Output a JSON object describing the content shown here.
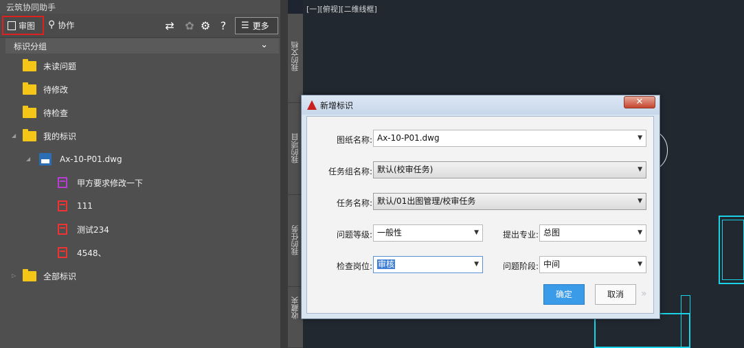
{
  "panel": {
    "title": "云筑协同助手",
    "toolbar": {
      "review_label": "审图",
      "collab_label": "协作",
      "more_label": "更多"
    },
    "group_header": "标识分组",
    "tree": [
      {
        "label": "未读问题"
      },
      {
        "label": "待修改"
      },
      {
        "label": "待检查"
      },
      {
        "label": "我的标识"
      },
      {
        "label": "Ax-10-P01.dwg"
      },
      {
        "label": "甲方要求修改一下"
      },
      {
        "label": "111"
      },
      {
        "label": "测试234"
      },
      {
        "label": "4548、"
      },
      {
        "label": "全部标识"
      }
    ]
  },
  "side_tabs": [
    "我的文档",
    "我的项目",
    "我的任务",
    "收藏夹"
  ],
  "canvas": {
    "viewport_label": "[一][俯视][二维线框]"
  },
  "dialog": {
    "title": "新增标识",
    "close_symbol": "✕",
    "fields": {
      "drawing_name": {
        "label": "图纸名称:",
        "value": "Ax-10-P01.dwg"
      },
      "task_group": {
        "label": "任务组名称:",
        "value": "默认(校审任务)"
      },
      "task_name": {
        "label": "任务名称:",
        "value": "默认/01出图管理/校审任务"
      },
      "issue_level": {
        "label": "问题等级:",
        "value": "一般性"
      },
      "discipline": {
        "label": "提出专业:",
        "value": "总图"
      },
      "check_post": {
        "label": "检查岗位:",
        "value": "审核"
      },
      "issue_stage": {
        "label": "问题阶段:",
        "value": "中间"
      }
    },
    "ok_label": "确定",
    "cancel_label": "取消"
  },
  "colors": {
    "accent": "#3a9be8",
    "highlight_border": "#e02020",
    "cad_line": "#19d4e6",
    "folder": "#f5c518"
  }
}
